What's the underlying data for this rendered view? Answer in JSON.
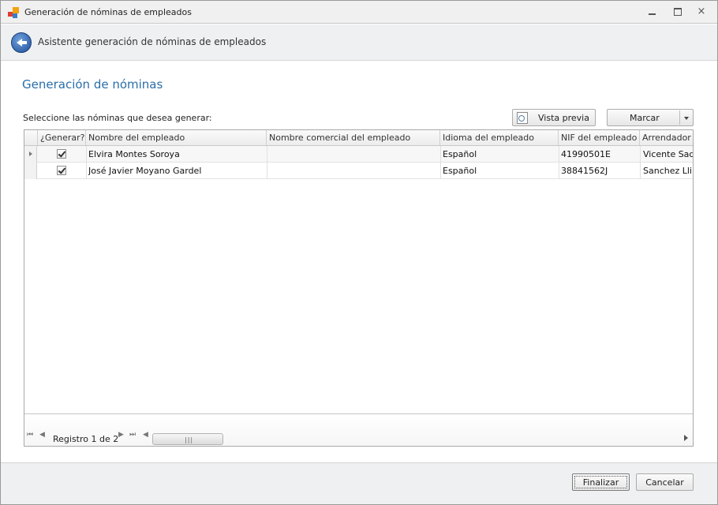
{
  "window": {
    "title": "Generación de nóminas de empleados",
    "close_glyph": "×"
  },
  "wizard": {
    "header_title": "Asistente generación de nóminas de empleados",
    "page_title": "Generación de nóminas",
    "select_label": "Seleccione las nóminas que desea generar:"
  },
  "toolbar": {
    "preview_label": "Vista previa",
    "mark_label": "Marcar"
  },
  "grid": {
    "columns": [
      "¿Generar?",
      "Nombre del empleado",
      "Nombre comercial del empleado",
      "Idioma del empleado",
      "NIF del empleado",
      "Arrendador"
    ],
    "rows": [
      {
        "generate": true,
        "name": "Elvira Montes Soroya",
        "trade_name": "",
        "language": "Español",
        "nif": "41990501E",
        "landlord": "Vicente Sadurni"
      },
      {
        "generate": true,
        "name": "José Javier Moyano Gardel",
        "trade_name": "",
        "language": "Español",
        "nif": "38841562J",
        "landlord": "Sanchez Llibre"
      }
    ],
    "navigator_text": "Registro 1 de 2",
    "scroll_grip": "|||"
  },
  "footer": {
    "finish_label": "Finalizar",
    "cancel_label": "Cancelar"
  },
  "colors": {
    "accent": "#2a6ea8",
    "header_bg": "#eff0f2"
  }
}
